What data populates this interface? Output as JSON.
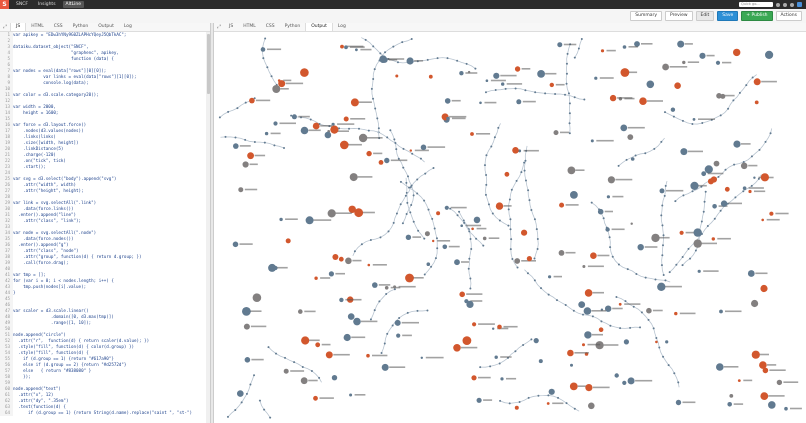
{
  "header": {
    "logo": "S",
    "breadcrumbs": [
      "SNCF",
      "Insights",
      "AltLine"
    ],
    "search_placeholder": "Quick go..."
  },
  "toolbar": {
    "summary": "Summary",
    "preview": "Preview",
    "edit": "Edit",
    "save": "Save",
    "publish": "+ Publish",
    "actions": "Actions"
  },
  "editor": {
    "tabs": [
      "JS",
      "HTML",
      "CSS",
      "Python",
      "Output",
      "Log"
    ],
    "active_tab": "JS",
    "lines": [
      "var apikey = \"EDw3hYNy9G0ZLAPHcYQeyJ5QbTkAC\";",
      "",
      "dataiku.dataset_object(\"SNCF\",",
      "                       \"graphenc\", apikey,",
      "                       function (data) {",
      "",
      "var nodes = eval(data[\"rows\"][0][0]);",
      "            var links = eval(data[\"rows\"][1][0]);",
      "            console.log(data);",
      "",
      "var color = d3.scale.category20();",
      "",
      "var width = 2000,",
      "    height = 1600;",
      "",
      "var force = d3.layout.force()",
      "    .nodes(d3.values(nodes))",
      "    .links(links)",
      "    .size([width, height])",
      "    .linkDistance(5)",
      "    .charge(-120)",
      "    .on(\"tick\", tick)",
      "    .start();",
      "",
      "var svg = d3.select(\"body\").append(\"svg\")",
      "    .attr(\"width\", width)",
      "    .attr(\"height\", height);",
      "",
      "var link = svg.selectAll(\".link\")",
      "    .data(force.links())",
      "  .enter().append(\"line\")",
      "    .attr(\"class\", \"link\");",
      "",
      "var node = svg.selectAll(\".node\")",
      "    .data(force.nodes())",
      "  .enter().append(\"g\")",
      "    .attr(\"class\", \"node\")",
      "    .attr(\"group\", function(d) { return d.group; })",
      "    .call(force.drag);",
      "",
      "var tmp = [];",
      "for (var i = 0; i < nodes.length; i++) {",
      "    tmp.push(nodes[i].value);",
      "}",
      "",
      "",
      "var scaler = d3.scale.linear()",
      "               .domain([0, d3.max(tmp)])",
      "               .range([1, 10]);",
      "",
      "node.append(\"circle\")",
      "  .attr(\"r\",  function(d) { return scaler(d.value); })",
      "  .style(\"fill\", function(d) { color(d.group) })",
      "  .style(\"fill\", function(d) {",
      "    if (d.group == 1) {return \"#617a90\"}",
      "    else if (d.group == 2) {return \"#d2572d\"}",
      "    else   { return \"#838080\" }",
      "    });",
      "",
      "node.append(\"text\")",
      "  .attr(\"x\", 12)",
      "  .attr(\"dy\", \".35em\")",
      "  .text(function(d) {",
      "      if (d.group == 1) {return String(d.name).replace(\"saint \", \"st-\")"
    ]
  },
  "output": {
    "tabs": [
      "JS",
      "HTML",
      "CSS",
      "Python",
      "Output",
      "Log"
    ],
    "active_tab": "Output"
  },
  "colors": {
    "blue_node": "#617a90",
    "orange_node": "#d2572d",
    "grey_node": "#838080",
    "link": "#b8c4d0"
  }
}
